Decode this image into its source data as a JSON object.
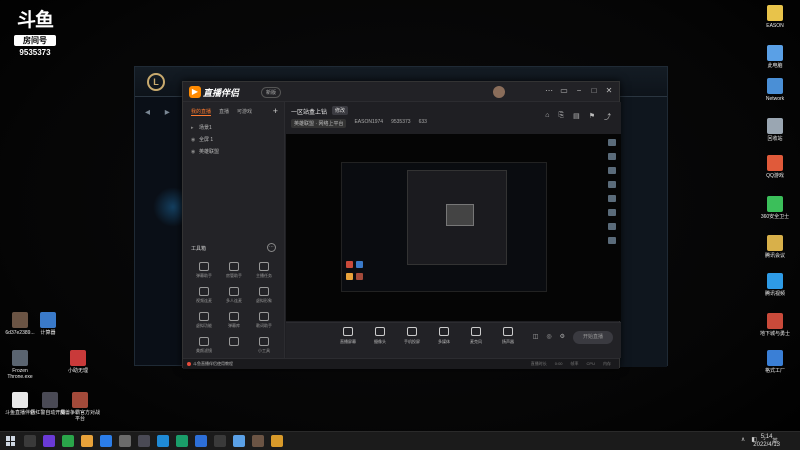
{
  "watermark": {
    "logo": "斗鱼",
    "label": "房间号",
    "room_number": "9535373"
  },
  "desktop_icons_right": [
    {
      "label": "EASON",
      "color": "#e8c34a"
    },
    {
      "label": "此电脑",
      "color": "#5aa0e6"
    },
    {
      "label": "Network",
      "color": "#4a8fd6"
    },
    {
      "label": "回收站",
      "color": "#9aa6b2"
    },
    {
      "label": "QQ游戏",
      "color": "#e05a3a"
    },
    {
      "label": "360安全卫士",
      "color": "#3bbf5a"
    },
    {
      "label": "腾讯会议",
      "color": "#d8b04a"
    },
    {
      "label": "腾讯视频",
      "color": "#2e9be6"
    },
    {
      "label": "地下城与勇士",
      "color": "#c94a3a"
    },
    {
      "label": "格式工厂",
      "color": "#3a7fd6"
    }
  ],
  "desktop_icons_left": [
    {
      "label": "6d37e2389...",
      "color": "#6b5444"
    },
    {
      "label": "计算器",
      "color": "#3a7ac9"
    },
    {
      "label": "Frozen Throne.exe",
      "color": "#5a6470"
    },
    {
      "label": "小助无理",
      "color": "#c93a3a"
    },
    {
      "label": "斗鱼直播伴侣",
      "color": "#e8e8e8"
    },
    {
      "label": "新红警自动开局...",
      "color": "#4a4a55"
    },
    {
      "label": "魔兽争霸官方对战平台",
      "color": "#a34a3a"
    }
  ],
  "companion": {
    "app_title": "直播伴侣",
    "version": "新版",
    "window_buttons": [
      "⋯",
      "▭",
      "−",
      "□",
      "✕"
    ],
    "sidebar_tabs": [
      "我的直播",
      "直播",
      "可游戏"
    ],
    "add_scene": "+",
    "scenes": [
      {
        "icon": "▸",
        "label": "场景1"
      },
      {
        "icon": "◉",
        "label": "全屏 1"
      },
      {
        "icon": "◉",
        "label": "英雄联盟"
      }
    ],
    "tools_title": "工具箱",
    "tools_more": "⋯",
    "tools": [
      "弹幕助手",
      "房管助手",
      "主播任务",
      "视频连麦",
      "多人连麦",
      "虚拟形象",
      "虚拟功能",
      "弹幕库",
      "歌词助手",
      "美颜滤镜",
      "",
      "小工具"
    ],
    "stream_title": "一区站盒上钻",
    "edit_label": "修改",
    "meta": {
      "category": "英雄联盟 · 网络上平台",
      "user": "EASON1974",
      "room": "9535373",
      "fans": "633"
    },
    "header_icons": [
      "⌂",
      "⎘",
      "▤",
      "⚑",
      "⤴"
    ],
    "sources": [
      "直播屏幕",
      "摄像头",
      "手机投屏",
      "多媒体",
      "麦克风",
      "扬声器"
    ],
    "bottom_icons": [
      "◫",
      "◎",
      "⚙"
    ],
    "go_live": "开始直播",
    "status_notice": "斗鱼直播伴侣使用教程",
    "status_right": [
      "直播时长",
      "0:00",
      "帧率",
      "CPU",
      "内存"
    ]
  },
  "taskbar": {
    "apps": [
      "#3a3a3a",
      "#6a3ad6",
      "#2aa54a",
      "#e8a23a",
      "#2b7de9",
      "#6b6b6b",
      "#4a4a55",
      "#1f8ad6",
      "#1a9e6a",
      "#2d6fd8",
      "#3a3a3a",
      "#5aa0e6",
      "#6b5444",
      "#d89a2a"
    ],
    "tray": [
      "∧",
      "◧",
      "♪",
      "英"
    ],
    "time": "5:14",
    "date": "2022/4/13"
  }
}
